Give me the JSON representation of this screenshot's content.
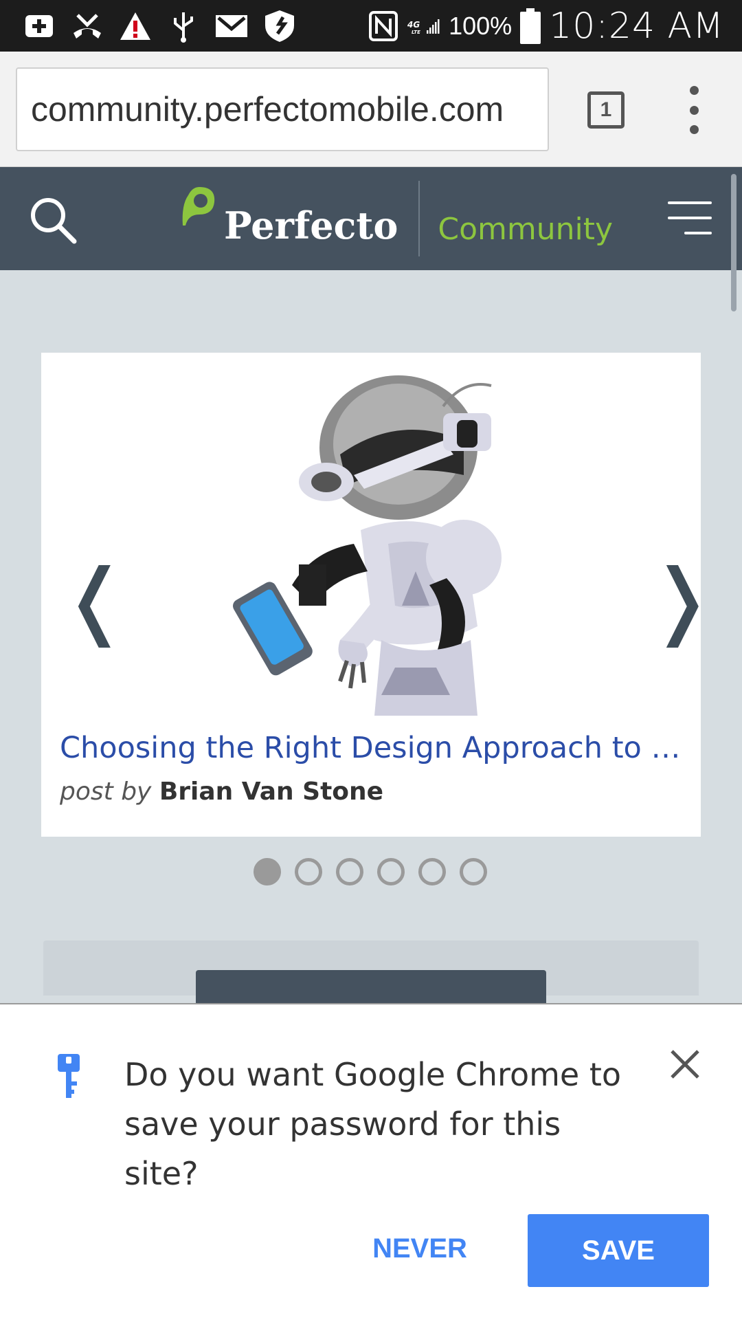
{
  "status_bar": {
    "battery": "100%",
    "time": "10:24 AM",
    "network": "4G LTE",
    "icons": [
      "add-icon",
      "missed-call-icon",
      "warning-icon",
      "usb-icon",
      "gmail-icon",
      "shield-icon",
      "nfc-icon",
      "signal-icon",
      "battery-icon"
    ]
  },
  "browser": {
    "url": "community.perfectomobile.com",
    "tab_count": "1"
  },
  "site_header": {
    "logo_text": "Perfecto",
    "logo_sub": "Community",
    "accent_color": "#8dc63f",
    "header_color": "#45525f"
  },
  "carousel": {
    "title": "Choosing the Right Design Approach to Automation",
    "post_by_prefix": "post by",
    "author": "Brian Van Stone",
    "prev_arrow": "❬",
    "next_arrow": "❭",
    "active_index": 0,
    "page_count": 6
  },
  "infobar": {
    "message": "Do you want Google Chrome to save your password for this site?",
    "never_label": "NEVER",
    "save_label": "SAVE",
    "button_color": "#4285f4"
  }
}
